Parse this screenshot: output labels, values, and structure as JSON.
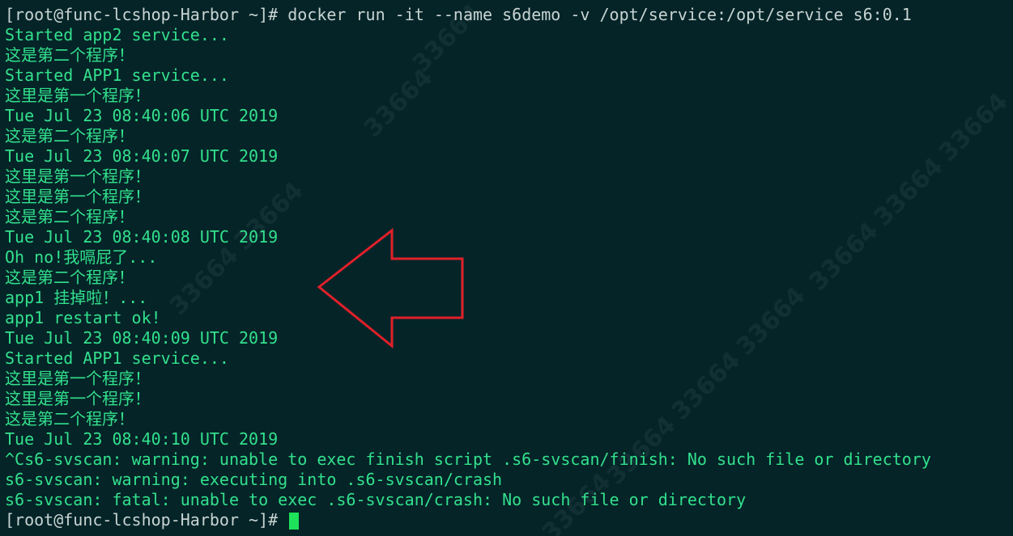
{
  "terminal": {
    "prompt": "[root@func-lcshop-Harbor ~]# ",
    "command": "docker run -it --name s6demo -v /opt/service:/opt/service s6:0.1",
    "output_lines": [
      "Started app2 service...",
      "这是第二个程序！",
      "Started APP1 service...",
      "这里是第一个程序！",
      "Tue Jul 23 08:40:06 UTC 2019",
      "这是第二个程序！",
      "Tue Jul 23 08:40:07 UTC 2019",
      "这里是第一个程序！",
      "这里是第一个程序！",
      "这是第二个程序！",
      "Tue Jul 23 08:40:08 UTC 2019",
      "Oh no!我嗝屁了...",
      "这是第二个程序！",
      "app1 挂掉啦！...",
      "app1 restart ok!",
      "Tue Jul 23 08:40:09 UTC 2019",
      "Started APP1 service...",
      "这里是第一个程序！",
      "这里是第一个程序！",
      "这是第二个程序！",
      "Tue Jul 23 08:40:10 UTC 2019",
      "^Cs6-svscan: warning: unable to exec finish script .s6-svscan/finish: No such file or directory",
      "s6-svscan: warning: executing into .s6-svscan/crash",
      "s6-svscan: fatal: unable to exec .s6-svscan/crash: No such file or directory"
    ],
    "final_prompt": "[root@func-lcshop-Harbor ~]# "
  },
  "watermark": {
    "text": "33664"
  },
  "colors": {
    "background": "#042428",
    "prompt_text": "#c8d4d2",
    "output_text": "#33e08c",
    "cursor": "#1ee25a",
    "arrow": "#e0202a"
  },
  "icons": {
    "annotation": "left-arrow-icon"
  }
}
